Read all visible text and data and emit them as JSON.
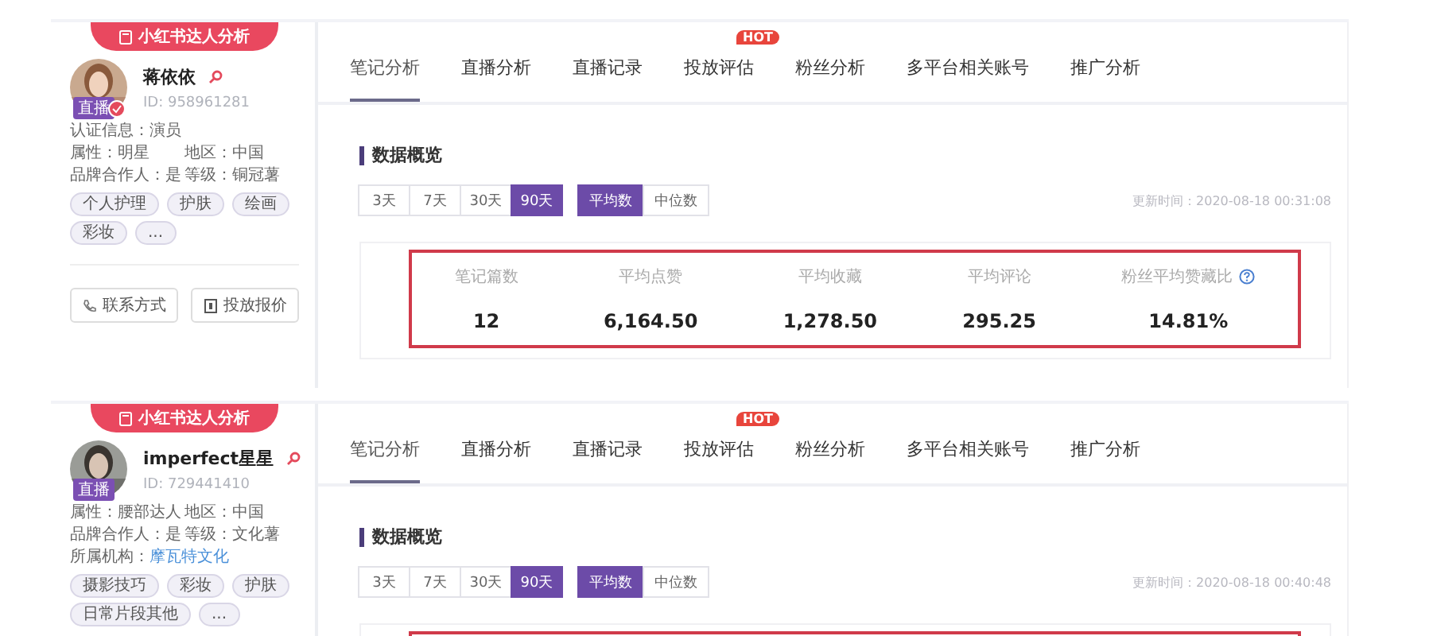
{
  "panels": [
    {
      "profile": {
        "badge": "小红书达人分析",
        "name": "蒋依依",
        "id": "ID: 958961281",
        "live_label": "直播",
        "verified": true,
        "info": [
          {
            "kind": "full",
            "label": "认证信息：",
            "value": "演员"
          },
          {
            "kind": "half",
            "label": "属性：",
            "value": "明星"
          },
          {
            "kind": "half",
            "label": "地区：",
            "value": "中国"
          },
          {
            "kind": "half",
            "label": "品牌合作人：",
            "value": "是"
          },
          {
            "kind": "half",
            "label": "等级：",
            "value": "铜冠薯"
          }
        ],
        "tags": [
          "个人护理",
          "护肤",
          "绘画",
          "彩妆",
          "..."
        ],
        "actions": [
          {
            "kind": "phone",
            "label": "联系方式"
          },
          {
            "kind": "quote",
            "label": "投放报价"
          }
        ]
      },
      "tabs": [
        {
          "label": "笔记分析",
          "selected": true
        },
        {
          "label": "直播分析",
          "selected": false
        },
        {
          "label": "直播记录",
          "selected": false
        },
        {
          "label": "投放评估",
          "selected": false,
          "badge": "HOT"
        },
        {
          "label": "粉丝分析",
          "selected": false
        },
        {
          "label": "多平台相关账号",
          "selected": false
        },
        {
          "label": "推广分析",
          "selected": false
        }
      ],
      "section_title": "数据概览",
      "ranges": [
        {
          "label": "3天",
          "selected": false
        },
        {
          "label": "7天",
          "selected": false
        },
        {
          "label": "30天",
          "selected": false
        },
        {
          "label": "90天",
          "selected": true
        }
      ],
      "modes": [
        {
          "label": "平均数",
          "selected": true
        },
        {
          "label": "中位数",
          "selected": false
        }
      ],
      "updated_time": "更新时间：2020-08-18 00:31:08",
      "stats": [
        {
          "label": "笔记篇数",
          "value": "12"
        },
        {
          "label": "平均点赞",
          "value": "6,164.50"
        },
        {
          "label": "平均收藏",
          "value": "1,278.50"
        },
        {
          "label": "平均评论",
          "value": "295.25"
        },
        {
          "label": "粉丝平均赞藏比",
          "value": "14.81%",
          "help": true
        }
      ]
    },
    {
      "profile": {
        "badge": "小红书达人分析",
        "name": "imperfect星星",
        "id": "ID: 729441410",
        "live_label": "直播",
        "verified": false,
        "info": [
          {
            "kind": "half",
            "label": "属性：",
            "value": "腰部达人"
          },
          {
            "kind": "half",
            "label": "地区：",
            "value": "中国"
          },
          {
            "kind": "half",
            "label": "品牌合作人：",
            "value": "是"
          },
          {
            "kind": "half",
            "label": "等级：",
            "value": "文化薯"
          },
          {
            "kind": "link",
            "label": "所属机构：",
            "value": "摩瓦特文化"
          }
        ],
        "tags": [
          "摄影技巧",
          "彩妆",
          "护肤",
          "日常片段其他",
          "..."
        ]
      },
      "tabs": [
        {
          "label": "笔记分析",
          "selected": true
        },
        {
          "label": "直播分析",
          "selected": false
        },
        {
          "label": "直播记录",
          "selected": false
        },
        {
          "label": "投放评估",
          "selected": false,
          "badge": "HOT"
        },
        {
          "label": "粉丝分析",
          "selected": false
        },
        {
          "label": "多平台相关账号",
          "selected": false
        },
        {
          "label": "推广分析",
          "selected": false
        }
      ],
      "section_title": "数据概览",
      "ranges": [
        {
          "label": "3天",
          "selected": false
        },
        {
          "label": "7天",
          "selected": false
        },
        {
          "label": "30天",
          "selected": false
        },
        {
          "label": "90天",
          "selected": true
        }
      ],
      "modes": [
        {
          "label": "平均数",
          "selected": true
        },
        {
          "label": "中位数",
          "selected": false
        }
      ],
      "updated_time": "更新时间：2020-08-18 00:40:48"
    }
  ]
}
